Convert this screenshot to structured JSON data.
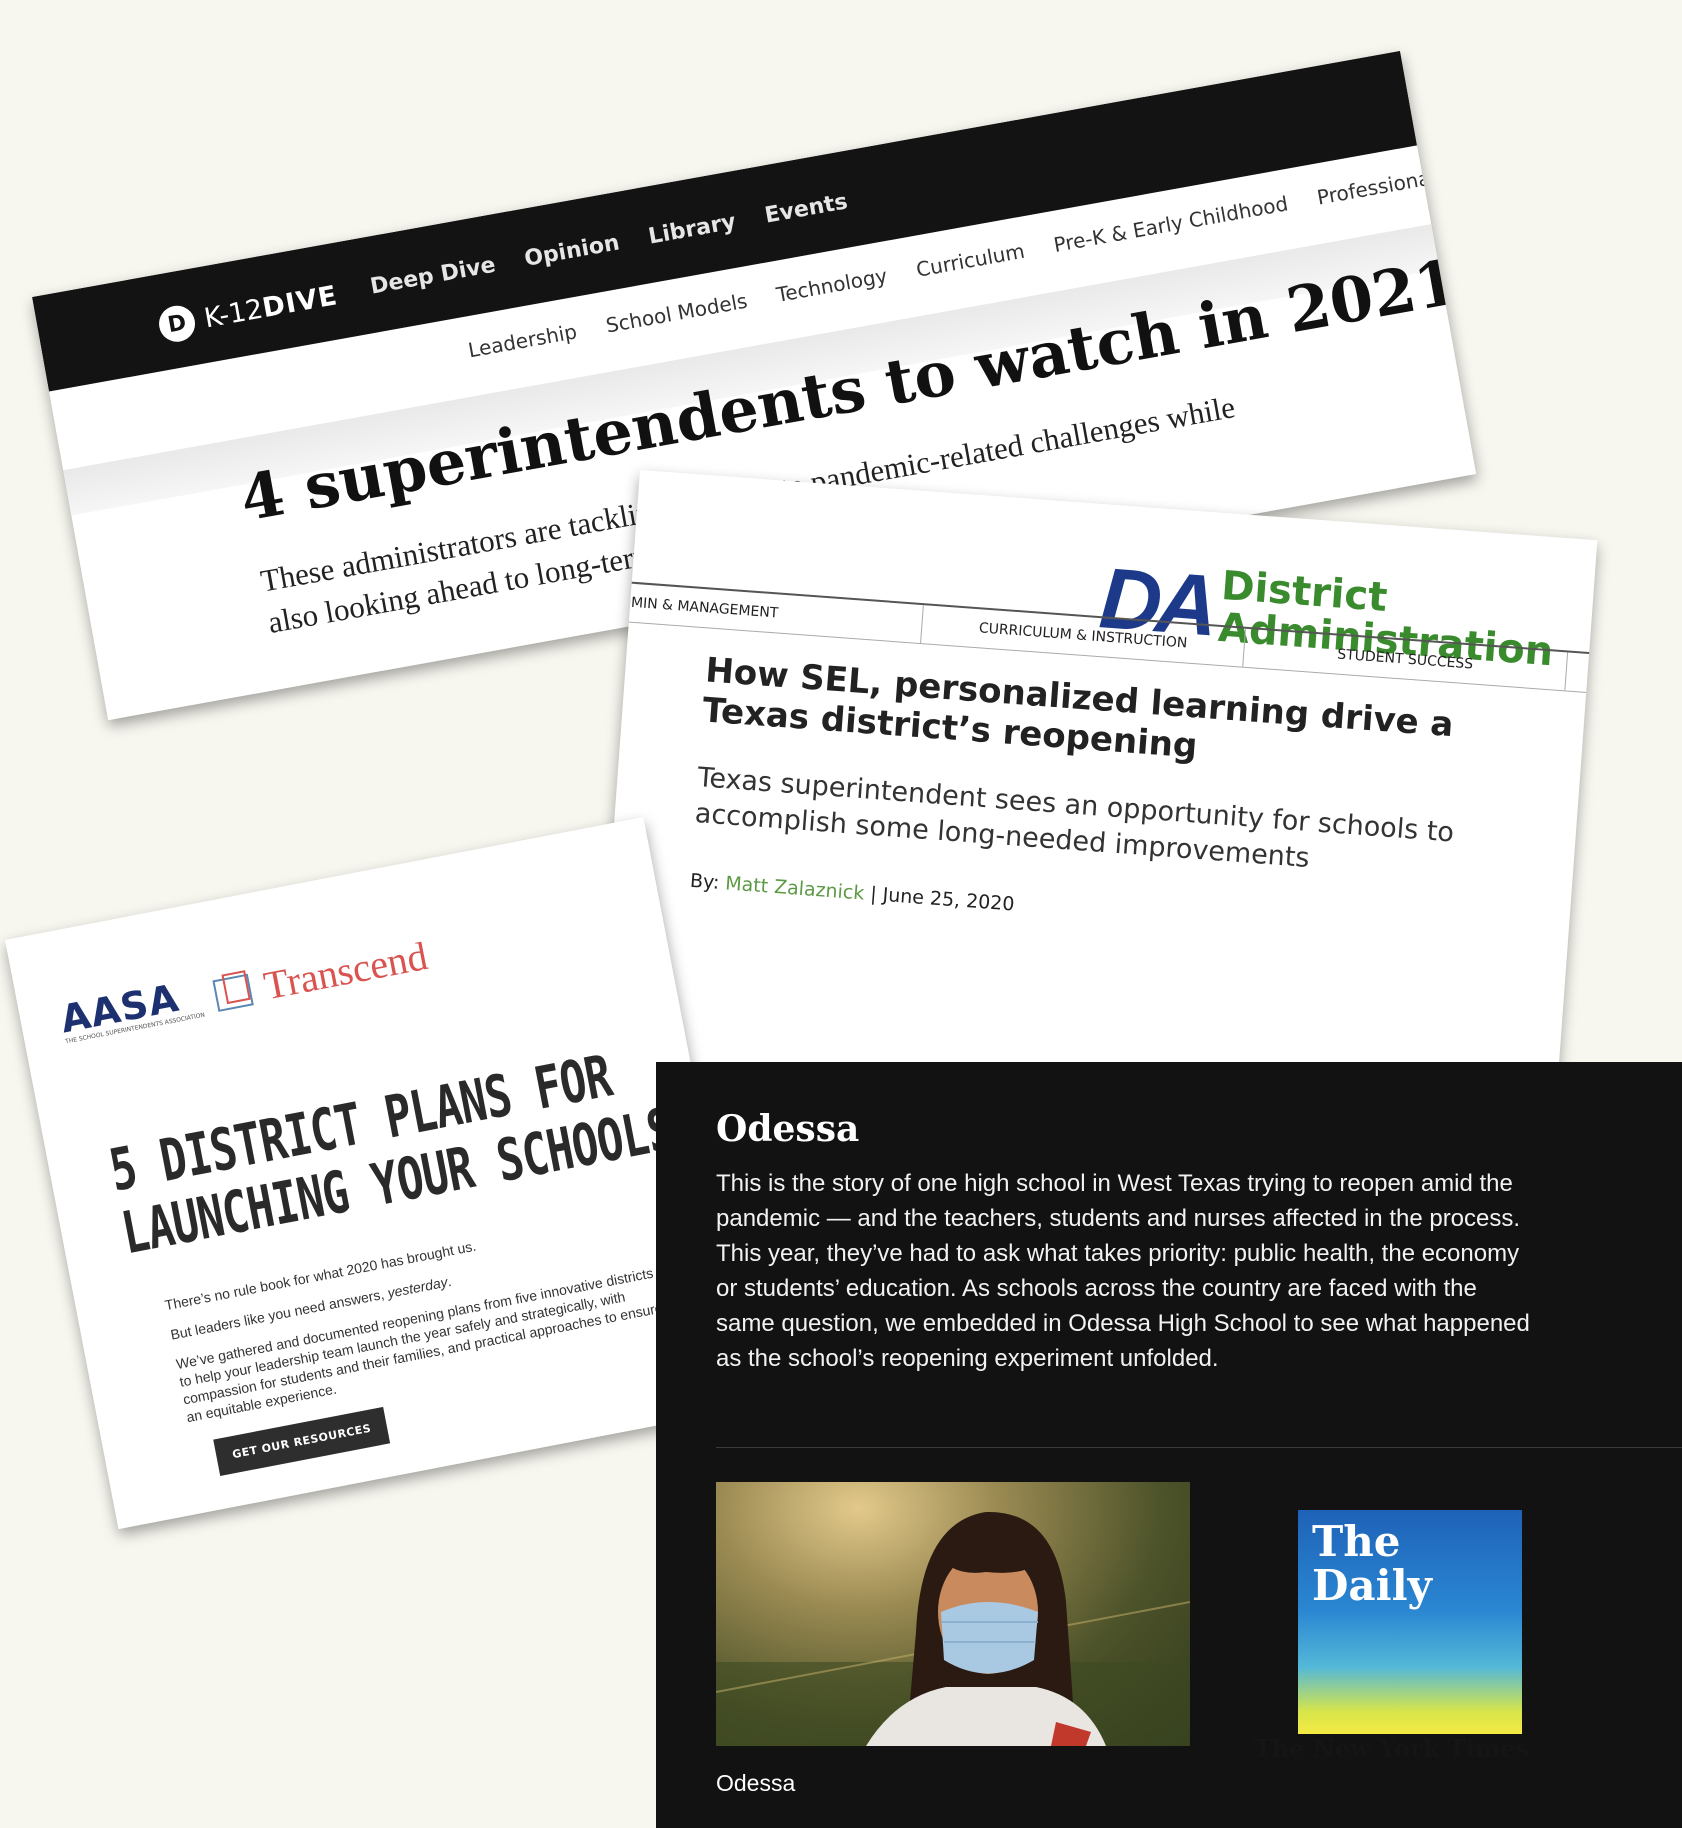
{
  "k12": {
    "logo_mark": "D",
    "logo_prefix": "K-12",
    "logo_bold": "DIVE",
    "topnav": [
      "Deep Dive",
      "Opinion",
      "Library",
      "Events"
    ],
    "subnav": [
      "Leadership",
      "School Models",
      "Technology",
      "Curriculum",
      "Pre-K & Early Childhood",
      "Professional Deve"
    ],
    "headline": "4 superintendents to watch in 2021",
    "dek": "These administrators are tackling immediate pandemic-related challenges while also looking ahead to long-term reform"
  },
  "da": {
    "logo_mark": "DA",
    "logo_line1": "District",
    "logo_line2": "Administration",
    "tabs": [
      "DMIN & MANAGEMENT",
      "CURRICULUM & INSTRUCTION",
      "STUDENT SUCCESS"
    ],
    "headline": "How SEL, personalized learning drive a Texas district’s reopening",
    "dek": "Texas superintendent sees an opportunity for schools to accomplish some long-needed improvements",
    "by_label": "By:",
    "author": "Matt Zalaznick",
    "date": "| June 25, 2020"
  },
  "aasa": {
    "aasa_logo": "AASA",
    "aasa_sub": "THE SCHOOL SUPERINTENDENTS ASSOCIATION",
    "transcend_logo": "Transcend",
    "headline_line1": "5 DISTRICT PLANS FOR",
    "headline_line2": "LAUNCHING YOUR SCHOOLS",
    "p1": "There’s no rule book for what 2020 has brought us.",
    "p2_start": "But leaders like you need answers, ",
    "p2_em": "yesterday",
    "p2_end": ".",
    "p3": "We’ve gathered and documented reopening plans from five innovative districts to help your leadership team launch the year safely and strategically, with compassion for students and their families, and practical approaches to ensure an equitable experience.",
    "button": "GET OUR RESOURCES"
  },
  "nyt": {
    "title": "Odessa",
    "description": "This is the story of one high school in West Texas trying to reopen amid the pandemic — and the teachers, students and nurses affected in the process. This year, they’ve had to ask what takes priority: public health, the economy or students’ education. As schools across the country are faced with the same question, we embedded in Odessa High School to see what happened as the school’s reopening experiment unfolded.",
    "photo_caption": "Odessa",
    "podcast_title_line1": "The",
    "podcast_title_line2": "Daily",
    "publisher": "The New York Times"
  }
}
